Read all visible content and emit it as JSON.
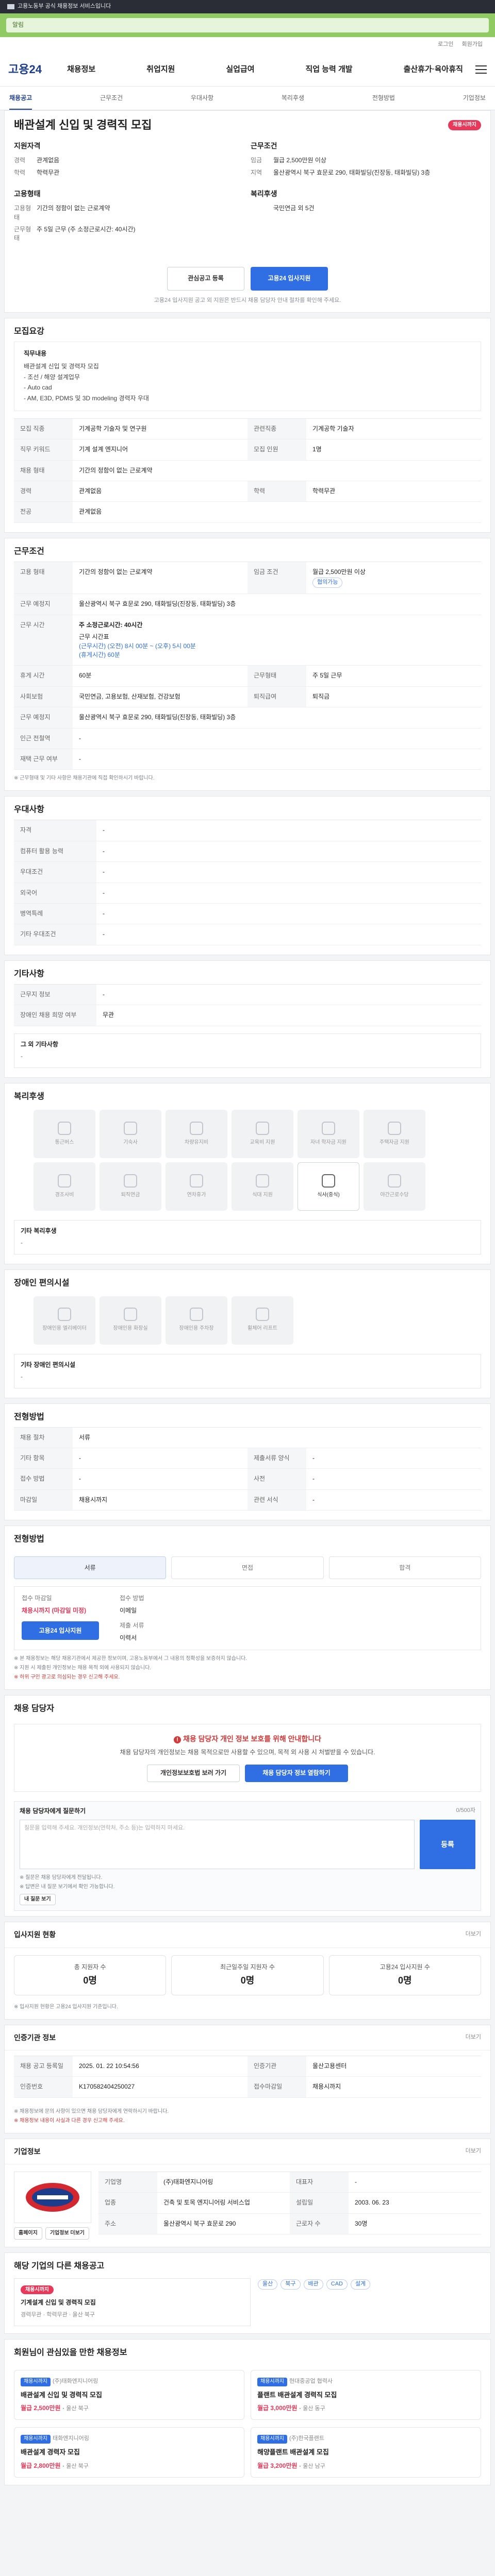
{
  "util_bar": {
    "text": "고용노동부 공식 채용정보 서비스입니다"
  },
  "green_bar": {
    "text": "알림"
  },
  "mini_nav": [
    "로그인",
    "회원가입"
  ],
  "logo": "고용24",
  "gnb": [
    "채용정보",
    "취업지원",
    "실업급여",
    "직업 능력 개발",
    "출산휴가·육아휴직"
  ],
  "tabs": [
    "채용공고",
    "근무조건",
    "우대사항",
    "복리후생",
    "전형방법",
    "기업정보"
  ],
  "header": {
    "badge": "채용시까지",
    "title": "배관설계 신입 및 경력직 모집"
  },
  "qualification": {
    "title": "지원자격",
    "rows": [
      {
        "k": "경력",
        "v": "관계없음"
      },
      {
        "k": "학력",
        "v": "학력무관"
      }
    ],
    "second_title": "고용형태",
    "second_rows": [
      {
        "k": "고용형태",
        "v": "기간의 정함이 없는 근로계약"
      },
      {
        "k": "근무형태",
        "v": "주 5일 근무 (주 소정근로시간: 40시간)"
      }
    ]
  },
  "conditions": {
    "title": "근무조건",
    "rows": [
      {
        "k": "임금",
        "v": "월급 2,500만원 이상"
      },
      {
        "k": "지역",
        "v": "울산광역시 북구 효문로 290, 태화빌딩(진장동, 태화빌딩) 3층"
      }
    ],
    "second_title": "복리후생",
    "second_rows": [
      {
        "k": "",
        "v": "국민연금 외 5건"
      }
    ]
  },
  "actions": {
    "scrap": "관심공고 등록",
    "apply": "고용24 입사지원"
  },
  "apply_note": "고용24 입사지원 공고 외 지원은 반드시 채용 담당자 안내 절차를 확인해 주세요.",
  "recruit_content": {
    "title": "모집요강",
    "job_title": "직무내용",
    "text": "배관설계 신입 및 경력자 모집\n- 조선 / 해양 설계업무\n- Auto cad\n- AM, E3D, PDMS 및 3D modeling 경력자 우대"
  },
  "recruit_grid": [
    {
      "k": "모집 직종",
      "v": "기계공학 기술자 및 연구원",
      "k2": "관련직종",
      "v2": "기계공학 기술자"
    },
    {
      "k": "직무 키워드",
      "v": "기계 설계 엔지니어",
      "k2": "모집 인원",
      "v2": "1명"
    },
    {
      "k": "채용 형태",
      "v": "기간의 정함이 없는 근로계약",
      "k2": "",
      "v2": ""
    },
    {
      "k": "경력",
      "v": "관계없음",
      "k2": "학력",
      "v2": "학력무관"
    },
    {
      "k": "전공",
      "v": "관계없음",
      "k2": "",
      "v2": ""
    }
  ],
  "work": {
    "title": "근무조건",
    "grid": [
      {
        "k": "고용 형태",
        "v": "기간의 정함이 없는 근로계약",
        "k2": "임금 조건",
        "v2": "월급 2,500만원 이상",
        "chip": "협의가능"
      },
      {
        "k": "근무 예정지",
        "v": "울산광역시 북구 효문로 290, 태화빌딩(진장동, 태화빌딩) 3층"
      }
    ],
    "schedule_head": "주 소정근로시간: 40시간",
    "schedule_lines": [
      "근무 시간표",
      "(근무시간) (오전) 8시 00분 ~ (오후) 5시 00분",
      "(휴게시간) 60분"
    ],
    "grid2": [
      {
        "k": "휴게 시간",
        "v": "60분",
        "k2": "근무형태",
        "v2": "주 5일 근무"
      },
      {
        "k": "사회보험",
        "v": "국민연금, 고용보험, 산재보험, 건강보험",
        "k2": "퇴직급여",
        "v2": "퇴직금"
      },
      {
        "k": "근무 예정지",
        "v": "울산광역시 북구 효문로 290, 태화빌딩(진장동, 태화빌딩) 3층",
        "k2": "",
        "v2": ""
      },
      {
        "k": "인근 전철역",
        "v": "-",
        "k2": "",
        "v2": ""
      },
      {
        "k": "재택 근무 여부",
        "v": "-",
        "k2": "",
        "v2": ""
      }
    ],
    "footnote": "※ 근무형태 및 기타 사항은 채용기관에 직접 확인하시기 바랍니다."
  },
  "prefer": {
    "title": "우대사항",
    "rows": [
      {
        "k": "자격",
        "v": "-"
      },
      {
        "k": "컴퓨터 활용 능력",
        "v": "-"
      },
      {
        "k": "우대조건",
        "v": "-"
      },
      {
        "k": "외국어",
        "v": "-"
      },
      {
        "k": "병역특례",
        "v": "-"
      },
      {
        "k": "기타 우대조건",
        "v": "-"
      }
    ]
  },
  "others": {
    "title": "기타사항",
    "rows": [
      {
        "k": "근무지 정보",
        "v": "-"
      },
      {
        "k": "장애인 채용 희망 여부",
        "v": "무관"
      }
    ],
    "extra_head": "그 외 기타사항",
    "extra": "-"
  },
  "welfare": {
    "title": "복리후생",
    "items": [
      "통근버스",
      "기숙사",
      "차량유지비",
      "교육비 지원",
      "자녀 학자금 지원",
      "주택자금 지원",
      "경조사비",
      "퇴직연금",
      "연차휴가",
      "식대 지원",
      "식사(중식)",
      "야간근로수당"
    ],
    "active_index": 10,
    "extra_head": "기타 복리후생",
    "extra": "-"
  },
  "disabled": {
    "title": "장애인 편의시설",
    "items": [
      "장애인용 엘리베이터",
      "장애인용 화장실",
      "장애인용 주차장",
      "휠체어 리프트"
    ],
    "extra_head": "기타 장애인 편의시설",
    "extra": "-"
  },
  "hiring_process": {
    "title": "전형방법",
    "rows": [
      {
        "k": "채용 절차",
        "v": "서류",
        "k2": "",
        "v2": ""
      },
      {
        "k": "기타 항목",
        "v": "-",
        "k2": "제출서류 양식",
        "v2": "-"
      },
      {
        "k": "접수 방법",
        "v": "-",
        "k2": "사전",
        "v2": "-"
      },
      {
        "k": "마감일",
        "v": "채용시까지",
        "k2": "관련 서식",
        "v2": "-"
      }
    ]
  },
  "apply_method": {
    "title": "전형방법",
    "steps": [
      "서류",
      "면접",
      "합격"
    ],
    "deadline_label": "접수 마감일",
    "deadline": "채용시까지 (마감일 미정)",
    "method_label": "접수 방법",
    "method": "이메일",
    "docs_label": "제출 서류",
    "docs": "이력서",
    "apply_btn": "고용24 입사지원"
  },
  "apply_notes": [
    "※ 본 채용정보는 해당 채용기관에서 제공한 정보이며, 고용노동부에서 그 내용의 정확성을 보증하지 않습니다.",
    "※ 지원 시 제출된 개인정보는 채용 목적 외에 사용되지 않습니다.",
    "※ 허위 구인 광고로 의심되는 경우 신고해 주세요."
  ],
  "contact": {
    "title": "채용 담당자",
    "alert_title": "채용 담당자 개인 정보 보호를 위해 안내합니다",
    "alert_text": "채용 담당자의 개인정보는 채용 목적으로만 사용할 수 있으며, 목적 외 사용 시 처벌받을 수 있습니다.",
    "btn1": "개인정보보호법 보러 가기",
    "btn2": "채용 담당자 정보 열람하기"
  },
  "qna": {
    "title": "채용 담당자에게 질문하기",
    "counter": "0/500자",
    "placeholder": "질문을 입력해 주세요. 개인정보(연락처, 주소 등)는 입력하지 마세요.",
    "submit": "등록",
    "bullets": [
      "※ 질문은 채용 담당자에게 전달됩니다.",
      "※ 답변은 내 질문 보기에서 확인 가능합니다."
    ],
    "my_btn": "내 질문 보기"
  },
  "stats": {
    "title": "입사지원 현황",
    "more": "더보기",
    "items": [
      {
        "k": "총 지원자 수",
        "v": "0명"
      },
      {
        "k": "최근일주일 지원자 수",
        "v": "0명"
      },
      {
        "k": "고용24 입사지원 수",
        "v": "0명"
      }
    ],
    "note": "※ 입사지원 현황은 고용24 입사지원 기준입니다."
  },
  "info": {
    "title": "인증기관 정보",
    "more": "더보기",
    "rows": [
      {
        "k": "채용 공고 등록일",
        "v": "2025. 01. 22 10:54:56",
        "k2": "인증기관",
        "v2": "울산고용센터"
      },
      {
        "k": "인증번호",
        "v": "K170582404250027",
        "k2": "접수마감일",
        "v2": "채용시까지"
      }
    ],
    "notes": [
      "※ 채용정보에 문의 사항이 있으면 채용 담당자에게 연락하시기 바랍니다.",
      "※ 채용정보 내용이 사실과 다른 경우 신고해 주세요."
    ]
  },
  "company": {
    "title": "기업정보",
    "more": "더보기",
    "rows": [
      {
        "k": "기업명",
        "v": "(주)태화엔지니어링",
        "k2": "대표자",
        "v2": "-"
      },
      {
        "k": "업종",
        "v": "건축 및 토목 엔지니어링 서비스업",
        "k2": "설립일",
        "v2": "2003. 06. 23"
      },
      {
        "k": "주소",
        "v": "울산광역시 북구 효문로 290",
        "k2": "근로자 수",
        "v2": "30명"
      }
    ],
    "btn1": "홈페이지",
    "btn2": "기업정보 더보기"
  },
  "company_jobs": {
    "title": "해당 기업의 다른 채용공고",
    "jobs": [
      {
        "badge": "채용시까지",
        "title": "기계설계 신입 및 경력직 모집",
        "meta": "경력무관 · 학력무관 · 울산 북구"
      }
    ],
    "tags": [
      "울산",
      "북구",
      "배관",
      "CAD",
      "설계"
    ]
  },
  "recommend": {
    "title": "회원님이 관심있을 만한 채용정보",
    "cards": [
      {
        "badge": "채용시까지",
        "co": "(주)태화엔지니어링",
        "title": "배관설계 신입 및 경력직 모집",
        "wage": "월급 2,500만원",
        "loc": "울산 북구"
      },
      {
        "badge": "채용시까지",
        "co": "현대중공업 협력사",
        "title": "플랜트 배관설계 경력직 모집",
        "wage": "월급 3,000만원",
        "loc": "울산 동구"
      },
      {
        "badge": "채용시까지",
        "co": "태화엔지니어링",
        "title": "배관설계 경력자 모집",
        "wage": "월급 2,800만원",
        "loc": "울산 북구"
      },
      {
        "badge": "채용시까지",
        "co": "(주)한국플랜트",
        "title": "해양플랜트 배관설계 모집",
        "wage": "월급 3,200만원",
        "loc": "울산 남구"
      }
    ]
  }
}
